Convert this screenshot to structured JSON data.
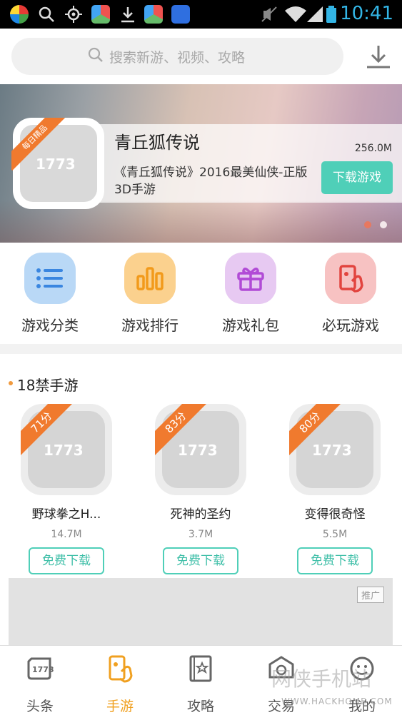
{
  "status_bar": {
    "time": "10:41"
  },
  "header": {
    "search_placeholder": "搜索新游、视频、攻略"
  },
  "banner": {
    "badge": "每日精品",
    "title": "青丘狐传说",
    "size": "256.0M",
    "description": "《青丘狐传说》2016最美仙侠-正版3D手游",
    "button": "下载游戏",
    "active_dot_color": "#e8785f"
  },
  "categories": [
    {
      "label": "游戏分类",
      "icon": "list-icon",
      "color": "#b9d8f6"
    },
    {
      "label": "游戏排行",
      "icon": "bar-chart-icon",
      "color": "#fbd18e"
    },
    {
      "label": "游戏礼包",
      "icon": "gift-icon",
      "color": "#e7c9f2"
    },
    {
      "label": "必玩游戏",
      "icon": "phone-hand-icon",
      "color": "#f7c2c2"
    }
  ],
  "section": {
    "title": "18禁手游",
    "games": [
      {
        "score": "71分",
        "name": "野球拳之H...",
        "size": "14.7M",
        "button": "免费下载"
      },
      {
        "score": "83分",
        "name": "死神的圣约",
        "size": "3.7M",
        "button": "免费下载"
      },
      {
        "score": "80分",
        "name": "变得很奇怪",
        "size": "5.5M",
        "button": "免费下载"
      }
    ],
    "ad_tag": "推广"
  },
  "tabs": [
    {
      "label": "头条",
      "icon": "news-icon",
      "active": false
    },
    {
      "label": "手游",
      "icon": "mobile-game-icon",
      "active": true
    },
    {
      "label": "攻略",
      "icon": "guide-book-icon",
      "active": false
    },
    {
      "label": "交易",
      "icon": "trade-icon",
      "active": false
    },
    {
      "label": "我的",
      "icon": "profile-icon",
      "active": false
    }
  ],
  "watermark": {
    "text": "网侠手机站",
    "url": "WWW.HACKHOME.COM"
  },
  "colors": {
    "accent": "#4fcfb8",
    "score_ribbon": "#f07a2e",
    "active_tab": "#f0a020"
  }
}
